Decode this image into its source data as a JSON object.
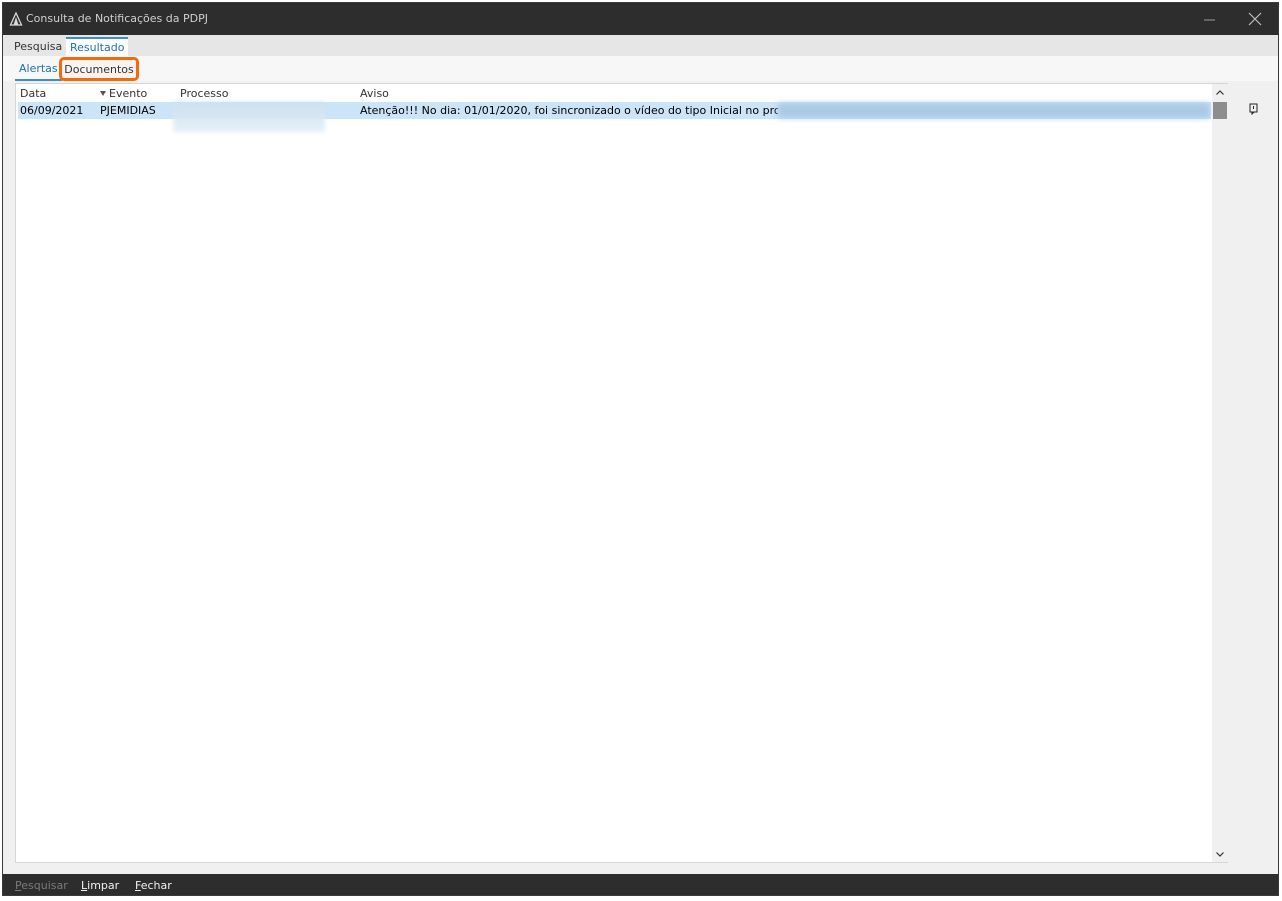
{
  "window": {
    "title": "Consulta de Notificações da PDPJ"
  },
  "tabs": [
    {
      "label": "Pesquisa"
    },
    {
      "label": "Resultado",
      "active": true
    }
  ],
  "subtabs": [
    {
      "label": "Alertas",
      "active": true
    },
    {
      "label": "Documentos",
      "highlighted": true
    }
  ],
  "grid": {
    "columns": [
      "Data",
      "Evento",
      "Processo",
      "Aviso"
    ],
    "sorted_column": "Evento",
    "rows": [
      {
        "data": "06/09/2021",
        "evento": "PJEMIDIAS",
        "processo": "",
        "aviso": "Atenção!!! No dia: 01/01/2020, foi sincronizado o vídeo do tipo Inicial no processo 0"
      }
    ]
  },
  "footer": {
    "pesquisar": "Pesquisar",
    "limpar": "Limpar",
    "fechar": "Fechar"
  },
  "colors": {
    "titlebar": "#2d2d2d",
    "accent": "#3c8dd0",
    "selection": "#cce4f7",
    "highlight_border": "#f06a10"
  }
}
